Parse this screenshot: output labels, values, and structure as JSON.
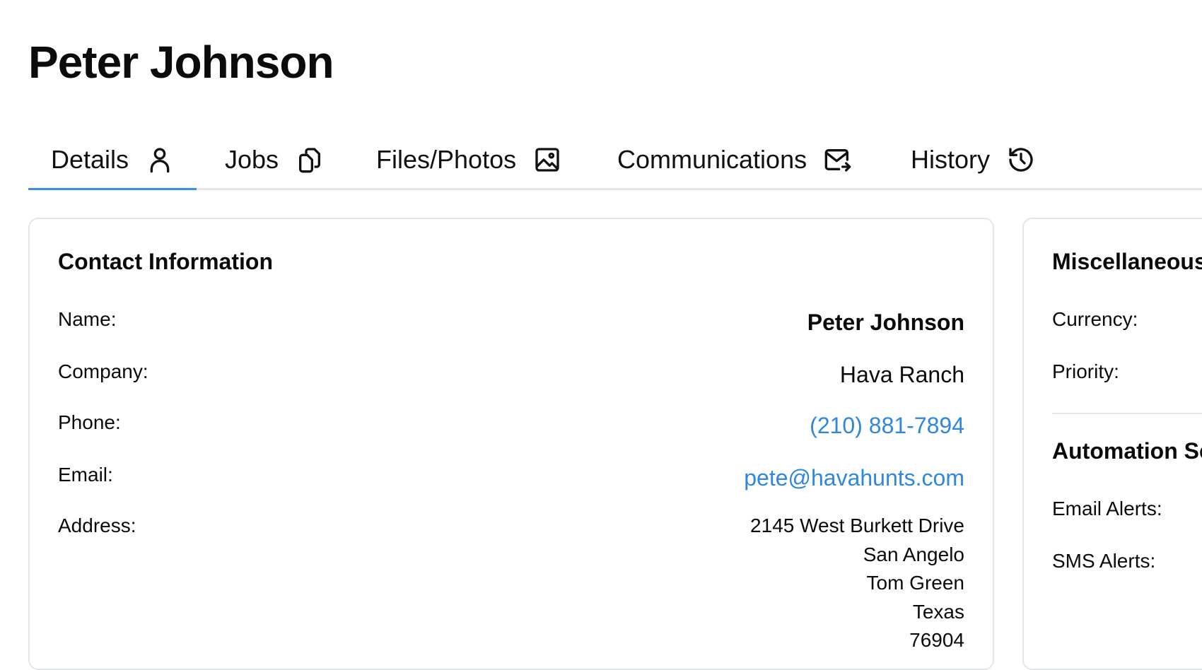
{
  "page_title": "Peter Johnson",
  "tabs": [
    {
      "label": "Details",
      "icon": "user-icon",
      "active": true
    },
    {
      "label": "Jobs",
      "icon": "copy-icon",
      "active": false
    },
    {
      "label": "Files/Photos",
      "icon": "image-icon",
      "active": false
    },
    {
      "label": "Communications",
      "icon": "mail-forward-icon",
      "active": false
    },
    {
      "label": "History",
      "icon": "history-icon",
      "active": false
    }
  ],
  "contact": {
    "title": "Contact Information",
    "name_label": "Name:",
    "name_value": "Peter Johnson",
    "company_label": "Company:",
    "company_value": "Hava Ranch",
    "phone_label": "Phone:",
    "phone_value": "(210) 881-7894",
    "email_label": "Email:",
    "email_value": "pete@havahunts.com",
    "address_label": "Address:",
    "address_lines": [
      "2145 West Burkett Drive",
      "San Angelo",
      "Tom Green",
      "Texas",
      "76904"
    ]
  },
  "misc": {
    "title": "Miscellaneous",
    "currency_label": "Currency:",
    "priority_label": "Priority:",
    "automation_title": "Automation Se",
    "email_alerts_label": "Email Alerts:",
    "sms_alerts_label": "SMS Alerts:"
  },
  "colors": {
    "accent": "#3a8ee6",
    "link": "#2f87e0",
    "border": "#e4e6ea",
    "text": "#0b0b0b"
  }
}
